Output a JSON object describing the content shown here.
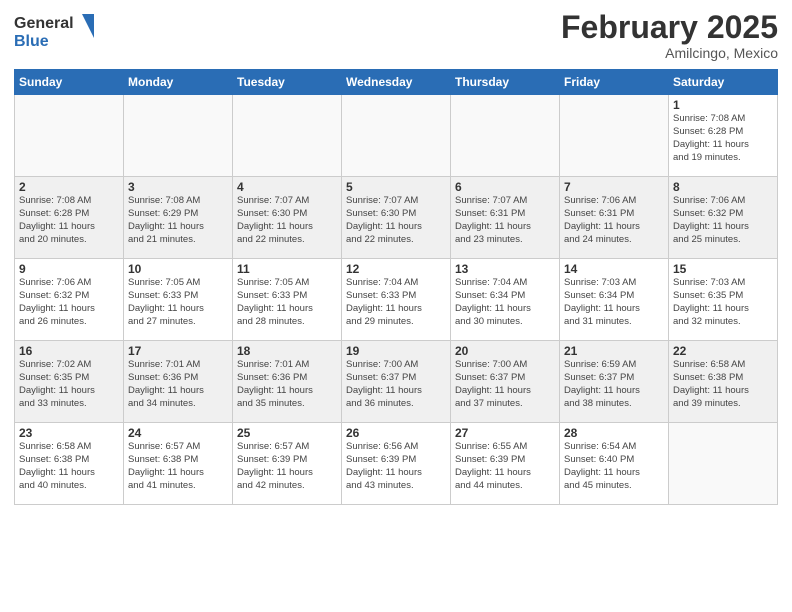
{
  "logo": {
    "line1": "General",
    "line2": "Blue"
  },
  "title": "February 2025",
  "location": "Amilcingo, Mexico",
  "weekdays": [
    "Sunday",
    "Monday",
    "Tuesday",
    "Wednesday",
    "Thursday",
    "Friday",
    "Saturday"
  ],
  "weeks": [
    [
      {
        "day": "",
        "info": ""
      },
      {
        "day": "",
        "info": ""
      },
      {
        "day": "",
        "info": ""
      },
      {
        "day": "",
        "info": ""
      },
      {
        "day": "",
        "info": ""
      },
      {
        "day": "",
        "info": ""
      },
      {
        "day": "1",
        "info": "Sunrise: 7:08 AM\nSunset: 6:28 PM\nDaylight: 11 hours\nand 19 minutes."
      }
    ],
    [
      {
        "day": "2",
        "info": "Sunrise: 7:08 AM\nSunset: 6:28 PM\nDaylight: 11 hours\nand 20 minutes."
      },
      {
        "day": "3",
        "info": "Sunrise: 7:08 AM\nSunset: 6:29 PM\nDaylight: 11 hours\nand 21 minutes."
      },
      {
        "day": "4",
        "info": "Sunrise: 7:07 AM\nSunset: 6:30 PM\nDaylight: 11 hours\nand 22 minutes."
      },
      {
        "day": "5",
        "info": "Sunrise: 7:07 AM\nSunset: 6:30 PM\nDaylight: 11 hours\nand 22 minutes."
      },
      {
        "day": "6",
        "info": "Sunrise: 7:07 AM\nSunset: 6:31 PM\nDaylight: 11 hours\nand 23 minutes."
      },
      {
        "day": "7",
        "info": "Sunrise: 7:06 AM\nSunset: 6:31 PM\nDaylight: 11 hours\nand 24 minutes."
      },
      {
        "day": "8",
        "info": "Sunrise: 7:06 AM\nSunset: 6:32 PM\nDaylight: 11 hours\nand 25 minutes."
      }
    ],
    [
      {
        "day": "9",
        "info": "Sunrise: 7:06 AM\nSunset: 6:32 PM\nDaylight: 11 hours\nand 26 minutes."
      },
      {
        "day": "10",
        "info": "Sunrise: 7:05 AM\nSunset: 6:33 PM\nDaylight: 11 hours\nand 27 minutes."
      },
      {
        "day": "11",
        "info": "Sunrise: 7:05 AM\nSunset: 6:33 PM\nDaylight: 11 hours\nand 28 minutes."
      },
      {
        "day": "12",
        "info": "Sunrise: 7:04 AM\nSunset: 6:33 PM\nDaylight: 11 hours\nand 29 minutes."
      },
      {
        "day": "13",
        "info": "Sunrise: 7:04 AM\nSunset: 6:34 PM\nDaylight: 11 hours\nand 30 minutes."
      },
      {
        "day": "14",
        "info": "Sunrise: 7:03 AM\nSunset: 6:34 PM\nDaylight: 11 hours\nand 31 minutes."
      },
      {
        "day": "15",
        "info": "Sunrise: 7:03 AM\nSunset: 6:35 PM\nDaylight: 11 hours\nand 32 minutes."
      }
    ],
    [
      {
        "day": "16",
        "info": "Sunrise: 7:02 AM\nSunset: 6:35 PM\nDaylight: 11 hours\nand 33 minutes."
      },
      {
        "day": "17",
        "info": "Sunrise: 7:01 AM\nSunset: 6:36 PM\nDaylight: 11 hours\nand 34 minutes."
      },
      {
        "day": "18",
        "info": "Sunrise: 7:01 AM\nSunset: 6:36 PM\nDaylight: 11 hours\nand 35 minutes."
      },
      {
        "day": "19",
        "info": "Sunrise: 7:00 AM\nSunset: 6:37 PM\nDaylight: 11 hours\nand 36 minutes."
      },
      {
        "day": "20",
        "info": "Sunrise: 7:00 AM\nSunset: 6:37 PM\nDaylight: 11 hours\nand 37 minutes."
      },
      {
        "day": "21",
        "info": "Sunrise: 6:59 AM\nSunset: 6:37 PM\nDaylight: 11 hours\nand 38 minutes."
      },
      {
        "day": "22",
        "info": "Sunrise: 6:58 AM\nSunset: 6:38 PM\nDaylight: 11 hours\nand 39 minutes."
      }
    ],
    [
      {
        "day": "23",
        "info": "Sunrise: 6:58 AM\nSunset: 6:38 PM\nDaylight: 11 hours\nand 40 minutes."
      },
      {
        "day": "24",
        "info": "Sunrise: 6:57 AM\nSunset: 6:38 PM\nDaylight: 11 hours\nand 41 minutes."
      },
      {
        "day": "25",
        "info": "Sunrise: 6:57 AM\nSunset: 6:39 PM\nDaylight: 11 hours\nand 42 minutes."
      },
      {
        "day": "26",
        "info": "Sunrise: 6:56 AM\nSunset: 6:39 PM\nDaylight: 11 hours\nand 43 minutes."
      },
      {
        "day": "27",
        "info": "Sunrise: 6:55 AM\nSunset: 6:39 PM\nDaylight: 11 hours\nand 44 minutes."
      },
      {
        "day": "28",
        "info": "Sunrise: 6:54 AM\nSunset: 6:40 PM\nDaylight: 11 hours\nand 45 minutes."
      },
      {
        "day": "",
        "info": ""
      }
    ]
  ]
}
